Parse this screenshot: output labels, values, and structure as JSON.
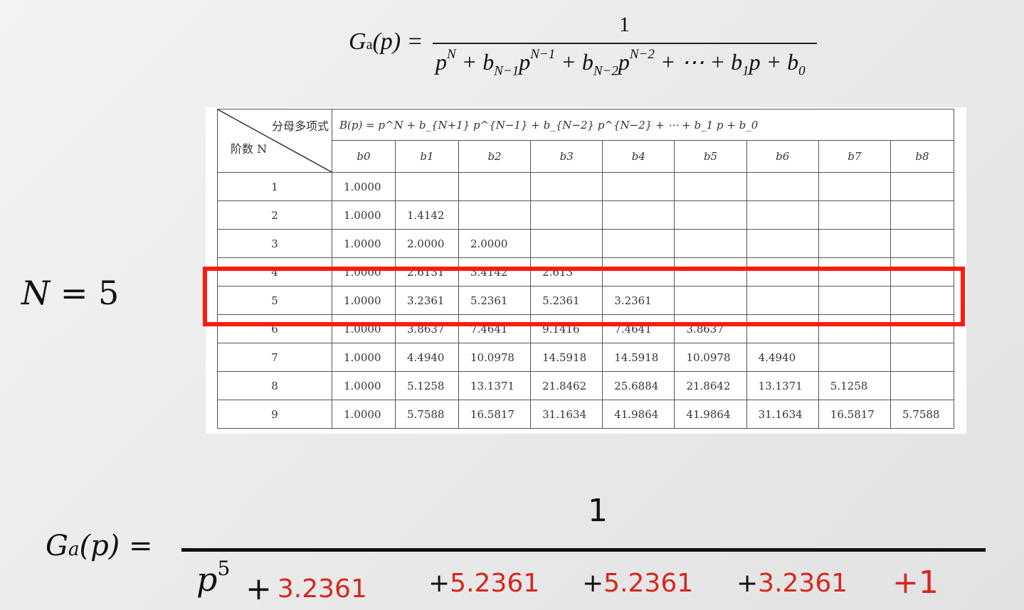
{
  "top_formula": {
    "lhs": "G",
    "lhs_sub": "a",
    "lhs_arg": "(p) =",
    "numerator": "1",
    "den": {
      "t1": "p",
      "t1_sup": "N",
      "t2": "+ b",
      "t2_sub": "N−1",
      "t2p": "p",
      "t2_sup": "N−1",
      "t3": "+ b",
      "t3_sub": "N−2",
      "t3p": "p",
      "t3_sup": "N−2",
      "t4": "+ ⋯ + b",
      "t4_sub": "1",
      "t4p": "p + b",
      "t4_sub2": "0"
    }
  },
  "table": {
    "corner_top": "分母多项式",
    "corner_bottom": "阶数 N",
    "poly_header": "B(p) = p^N + b_{N+1} p^{N−1} + b_{N−2} p^{N−2} + ⋯ + b_1 p + b_0",
    "coef_headers": [
      "b0",
      "b1",
      "b2",
      "b3",
      "b4",
      "b5",
      "b6",
      "b7",
      "b8"
    ],
    "rows": [
      {
        "order": "1",
        "values": [
          "1.0000",
          "",
          "",
          "",
          "",
          "",
          "",
          "",
          ""
        ]
      },
      {
        "order": "2",
        "values": [
          "1.0000",
          "1.4142",
          "",
          "",
          "",
          "",
          "",
          "",
          ""
        ]
      },
      {
        "order": "3",
        "values": [
          "1.0000",
          "2.0000",
          "2.0000",
          "",
          "",
          "",
          "",
          "",
          ""
        ]
      },
      {
        "order": "4",
        "values": [
          "1.0000",
          "2.6131",
          "3.4142",
          "2.613",
          "",
          "",
          "",
          "",
          ""
        ]
      },
      {
        "order": "5",
        "values": [
          "1.0000",
          "3.2361",
          "5.2361",
          "5.2361",
          "3.2361",
          "",
          "",
          "",
          ""
        ]
      },
      {
        "order": "6",
        "values": [
          "1.0000",
          "3.8637",
          "7.4641",
          "9.1416",
          "7.4641",
          "3.8637",
          "",
          "",
          ""
        ]
      },
      {
        "order": "7",
        "values": [
          "1.0000",
          "4.4940",
          "10.0978",
          "14.5918",
          "14.5918",
          "10.0978",
          "4.4940",
          "",
          ""
        ]
      },
      {
        "order": "8",
        "values": [
          "1.0000",
          "5.1258",
          "13.1371",
          "21.8462",
          "25.6884",
          "21.8642",
          "13.1371",
          "5.1258",
          ""
        ]
      },
      {
        "order": "9",
        "values": [
          "1.0000",
          "5.7588",
          "16.5817",
          "31.1634",
          "41.9864",
          "41.9864",
          "31.1634",
          "16.5817",
          "5.7588"
        ]
      }
    ]
  },
  "n_label": {
    "var": "N",
    "rest": " = 5"
  },
  "bottom_formula": {
    "lhs": "G",
    "lhs_sub": "a",
    "lhs_arg": "(p)",
    "eq": " =",
    "numerator": "1",
    "p": "p",
    "p_sup": "5",
    "terms": [
      {
        "plus": "+",
        "num": "3.2361"
      },
      {
        "plus": "+",
        "num": "5.2361"
      },
      {
        "plus": "+",
        "num": "5.2361"
      },
      {
        "plus": "+",
        "num": "3.2361"
      }
    ],
    "last": "+1"
  },
  "colors": {
    "highlight": "#ff1a0d",
    "coef_red": "#d4271f"
  }
}
